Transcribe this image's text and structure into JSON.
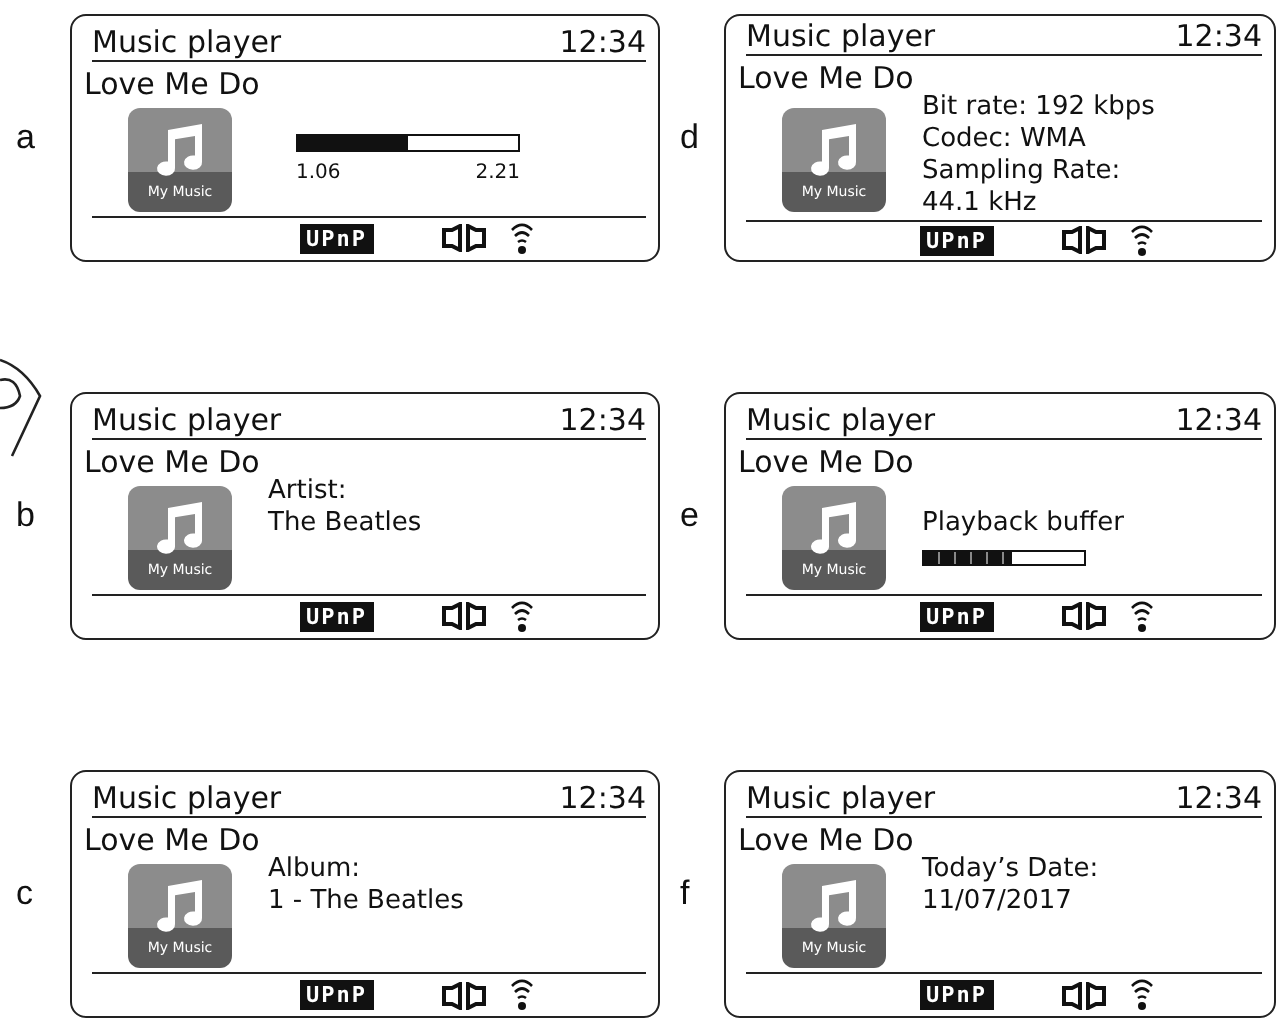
{
  "screens": [
    {
      "letter": "a",
      "title": "Music player",
      "time": "12:34",
      "track": "Love Me Do",
      "art_caption": "My Music",
      "kind": "progress",
      "level": 0.5,
      "elapsed": "1.06",
      "total": "2.21",
      "badge": "UPnP"
    },
    {
      "letter": "d",
      "title": "Music player",
      "time": "12:34",
      "track": "Love Me Do",
      "art_caption": "My Music",
      "kind": "info",
      "lines": [
        "Bit rate: 192 kbps",
        "Codec: WMA",
        "Sampling Rate:",
        "44.1 kHz"
      ],
      "badge": "UPnP"
    },
    {
      "letter": "b",
      "title": "Music player",
      "time": "12:34",
      "track": "Love Me Do",
      "art_caption": "My Music",
      "kind": "info",
      "lines": [
        "Artist:",
        "The Beatles"
      ],
      "badge": "UPnP"
    },
    {
      "letter": "e",
      "title": "Music player",
      "time": "12:34",
      "track": "Love Me Do",
      "art_caption": "My Music",
      "kind": "buffer",
      "label": "Playback buffer",
      "level": 0.55,
      "badge": "UPnP"
    },
    {
      "letter": "c",
      "title": "Music player",
      "time": "12:34",
      "track": "Love Me Do",
      "art_caption": "My Music",
      "kind": "info",
      "lines": [
        "Album:",
        "1 - The Beatles"
      ],
      "badge": "UPnP"
    },
    {
      "letter": "f",
      "title": "Music player",
      "time": "12:34",
      "track": "Love Me Do",
      "art_caption": "My Music",
      "kind": "info",
      "lines": [
        "Today’s Date:",
        "11/07/2017"
      ],
      "badge": "UPnP"
    }
  ]
}
